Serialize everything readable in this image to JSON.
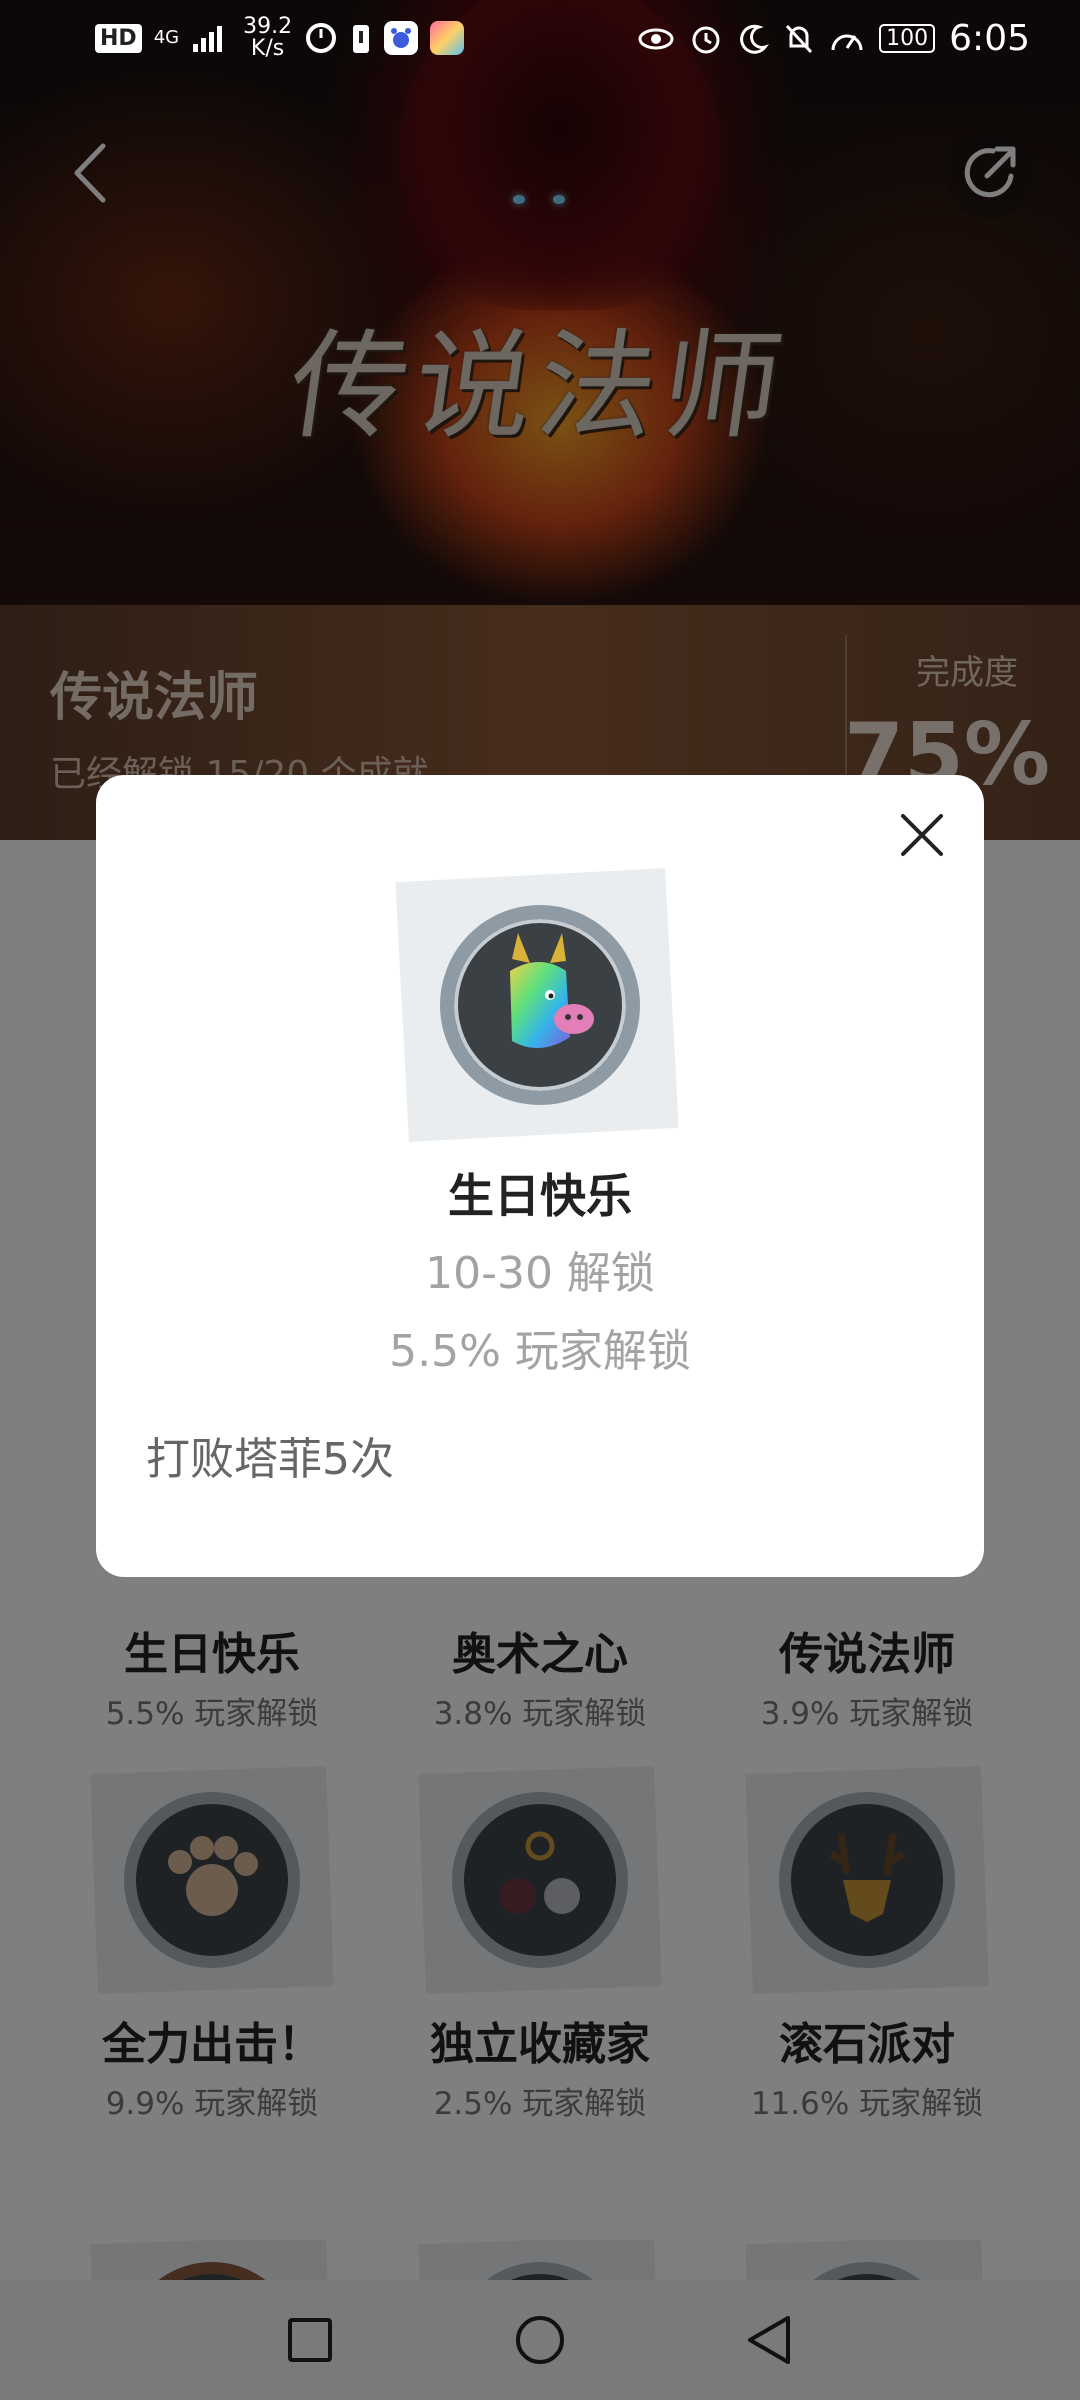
{
  "status_bar": {
    "network": "HD",
    "signal": "4G",
    "speed_value": "39.2",
    "speed_unit": "K/s",
    "battery": "100",
    "time": "6:05"
  },
  "hero": {
    "art_title": "传说法师"
  },
  "info": {
    "game_name": "传说法师",
    "unlock_count": "已经解锁 15/20 个成就",
    "completion_label": "完成度",
    "completion_value": "75%"
  },
  "achievements": [
    {
      "title": "生日快乐",
      "rate": "5.5% 玩家解锁"
    },
    {
      "title": "奥术之心",
      "rate": "3.8% 玩家解锁"
    },
    {
      "title": "传说法师",
      "rate": "3.9% 玩家解锁"
    },
    {
      "title": "全力出击！",
      "rate": "9.9% 玩家解锁"
    },
    {
      "title": "独立收藏家",
      "rate": "2.5% 玩家解锁"
    },
    {
      "title": "滚石派对",
      "rate": "11.6% 玩家解锁"
    }
  ],
  "modal": {
    "title": "生日快乐",
    "unlock_date": "10-30 解锁",
    "player_rate": "5.5% 玩家解锁",
    "description": "打败塔菲5次",
    "badge_icon": "rainbow-pig-icon"
  }
}
